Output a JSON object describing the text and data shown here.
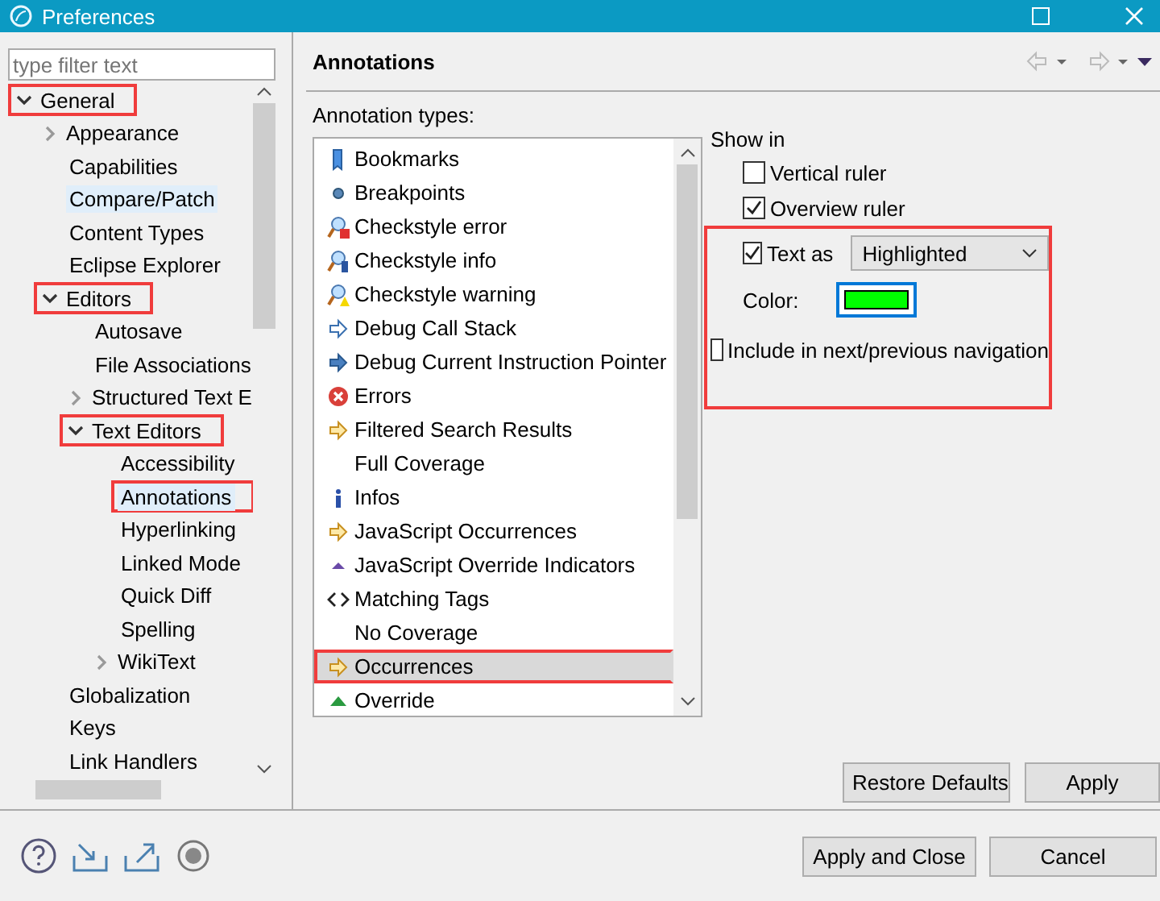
{
  "window": {
    "title": "Preferences"
  },
  "filter": {
    "placeholder": "type filter text"
  },
  "tree": [
    {
      "label": "General",
      "expanded": true,
      "marked": true,
      "selected": false,
      "children": [
        {
          "label": "Appearance",
          "expanded": false,
          "marked": false,
          "selected": false
        },
        {
          "label": "Capabilities",
          "marked": false,
          "selected": false
        },
        {
          "label": "Compare/Patch",
          "marked": false,
          "selected": true
        },
        {
          "label": "Content Types",
          "marked": false,
          "selected": false
        },
        {
          "label": "Eclipse Explorer",
          "marked": false,
          "selected": false
        },
        {
          "label": "Editors",
          "expanded": true,
          "marked": true,
          "selected": false,
          "children": [
            {
              "label": "Autosave",
              "marked": false,
              "selected": false
            },
            {
              "label": "File Associations",
              "marked": false,
              "selected": false
            },
            {
              "label": "Structured Text E",
              "expanded": false,
              "marked": false,
              "selected": false
            },
            {
              "label": "Text Editors",
              "expanded": true,
              "marked": true,
              "selected": false,
              "children": [
                {
                  "label": "Accessibility",
                  "marked": false,
                  "selected": false
                },
                {
                  "label": "Annotations",
                  "marked": true,
                  "selected": true
                },
                {
                  "label": "Hyperlinking",
                  "marked": false,
                  "selected": false
                },
                {
                  "label": "Linked Mode",
                  "marked": false,
                  "selected": false
                },
                {
                  "label": "Quick Diff",
                  "marked": false,
                  "selected": false
                },
                {
                  "label": "Spelling",
                  "marked": false,
                  "selected": false
                },
                {
                  "label": "WikiText",
                  "expanded": false,
                  "marked": false,
                  "selected": false
                }
              ]
            }
          ]
        },
        {
          "label": "Globalization",
          "marked": false,
          "selected": false
        },
        {
          "label": "Keys",
          "marked": false,
          "selected": false
        },
        {
          "label": "Link Handlers",
          "marked": false,
          "selected": false
        }
      ]
    }
  ],
  "page": {
    "title": "Annotations",
    "list_label": "Annotation types:"
  },
  "annotation_types": [
    {
      "label": "Bookmarks",
      "kind": "bookmark",
      "selected": false,
      "marked": false
    },
    {
      "label": "Breakpoints",
      "kind": "breakpoint",
      "selected": false,
      "marked": false
    },
    {
      "label": "Checkstyle error",
      "kind": "styleerror",
      "selected": false,
      "marked": false
    },
    {
      "label": "Checkstyle info",
      "kind": "styleinfo",
      "selected": false,
      "marked": false
    },
    {
      "label": "Checkstyle warning",
      "kind": "stylewarning",
      "selected": false,
      "marked": false
    },
    {
      "label": "Debug Call Stack",
      "kind": "stack",
      "selected": false,
      "marked": false
    },
    {
      "label": "Debug Current Instruction Pointer",
      "kind": "pointer",
      "selected": false,
      "marked": false
    },
    {
      "label": "Errors",
      "kind": "error",
      "selected": false,
      "marked": false
    },
    {
      "label": "Filtered Search Results",
      "kind": "occurrence",
      "selected": false,
      "marked": false
    },
    {
      "label": "Full Coverage",
      "kind": "plain",
      "selected": false,
      "marked": false
    },
    {
      "label": "Infos",
      "kind": "info",
      "selected": false,
      "marked": false
    },
    {
      "label": "JavaScript Occurrences",
      "kind": "occurrence",
      "selected": false,
      "marked": false
    },
    {
      "label": "JavaScript Override Indicators",
      "kind": "indicator",
      "selected": false,
      "marked": false
    },
    {
      "label": "Matching Tags",
      "kind": "tags",
      "selected": false,
      "marked": false
    },
    {
      "label": "No Coverage",
      "kind": "plain",
      "selected": false,
      "marked": false
    },
    {
      "label": "Occurrences",
      "kind": "occurrence",
      "selected": true,
      "marked": true
    },
    {
      "label": "Override",
      "kind": "override",
      "selected": false,
      "marked": false
    }
  ],
  "show_in": {
    "title": "Show in",
    "marked": true,
    "vertical_ruler": {
      "label": "Vertical ruler",
      "checked": false
    },
    "overview_ruler": {
      "label": "Overview ruler",
      "checked": true
    },
    "text_as": {
      "label": "Text as",
      "checked": true,
      "value": "Highlighted"
    },
    "color": {
      "label": "Color:",
      "color": "#00ff00"
    },
    "navigation": {
      "label": "Include in next/previous navigation",
      "checked": false
    }
  },
  "page_buttons": [
    "Restore Defaults",
    "Apply"
  ],
  "dialog_buttons": [
    "Apply and Close",
    "Cancel"
  ]
}
